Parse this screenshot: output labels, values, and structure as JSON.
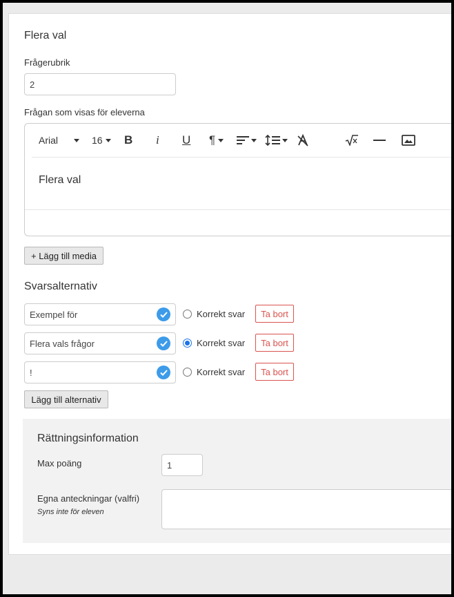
{
  "section_title": "Flera val",
  "question_title": {
    "label": "Frågerubrik",
    "value": "2"
  },
  "question_text": {
    "label": "Frågan som visas för eleverna",
    "toolbar": {
      "font_family": "Arial",
      "font_size": "16",
      "bold": "B",
      "italic": "i",
      "underline": "U"
    },
    "content": "Flera val"
  },
  "add_media_label": "+ Lägg till media",
  "answers": {
    "title": "Svarsalternativ",
    "correct_label": "Korrekt svar",
    "delete_label": "Ta bort",
    "items": [
      {
        "text": "Exempel för",
        "correct": false
      },
      {
        "text": "Flera vals frågor",
        "correct": true
      },
      {
        "text": "!",
        "correct": false
      }
    ],
    "add_label": "Lägg till alternativ"
  },
  "grading": {
    "title": "Rättningsinformation",
    "max_points_label": "Max poäng",
    "max_points_value": "1",
    "notes_label": "Egna anteckningar (valfri)",
    "notes_hint": "Syns inte för eleven",
    "notes_value": ""
  },
  "colors": {
    "accent": "#3d9be9",
    "danger": "#d9534f",
    "radio_selected": "#1a73e8"
  }
}
